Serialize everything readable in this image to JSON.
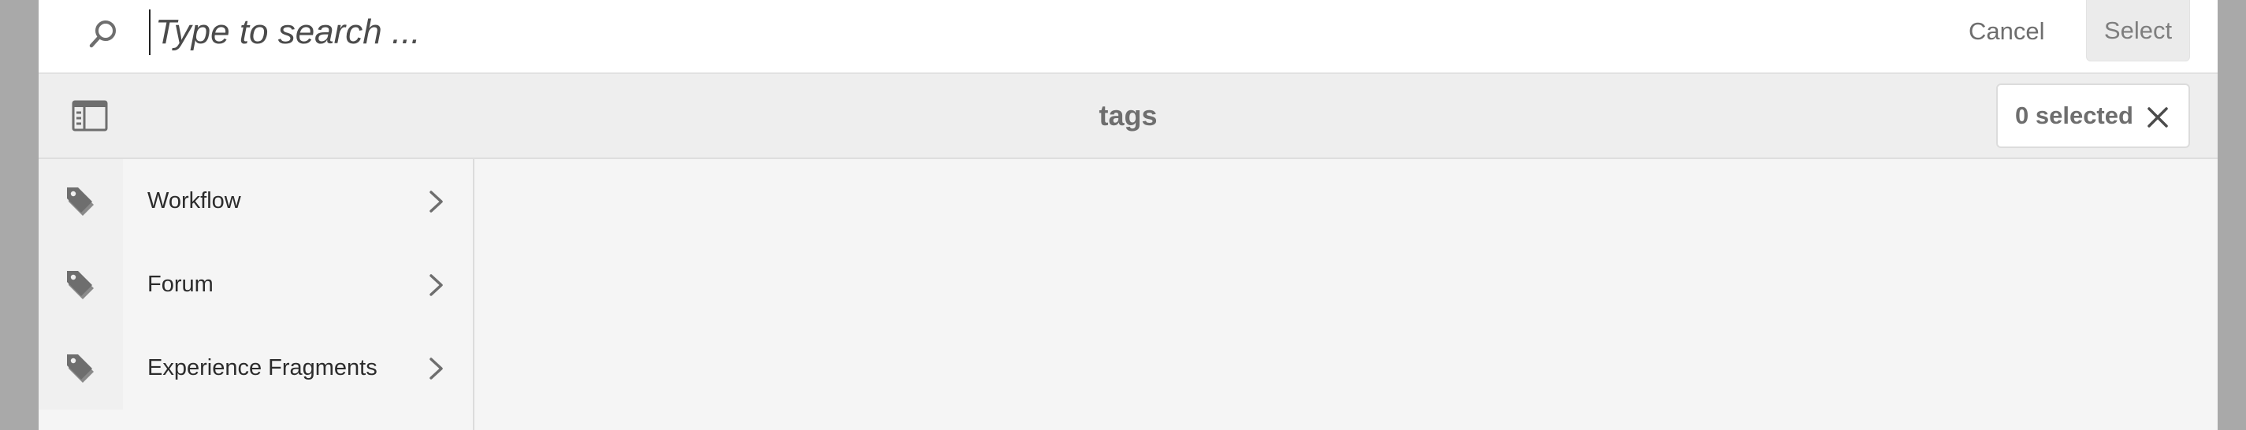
{
  "search": {
    "placeholder": "Type to search ...",
    "value": "",
    "cancel_label": "Cancel",
    "select_label": "Select"
  },
  "header": {
    "title": "tags",
    "selection_label": "0 selected"
  },
  "column": {
    "items": [
      {
        "label": "Workflow",
        "icon": "tag-icon"
      },
      {
        "label": "Forum",
        "icon": "tag-icon"
      },
      {
        "label": "Experience Fragments",
        "icon": "tag-icon"
      }
    ]
  },
  "colors": {
    "backdrop": "#a9a9a9",
    "surface": "#f5f5f5",
    "header": "#eeeeee",
    "icon": "#6e6e6e",
    "text": "#2c2c2c"
  }
}
